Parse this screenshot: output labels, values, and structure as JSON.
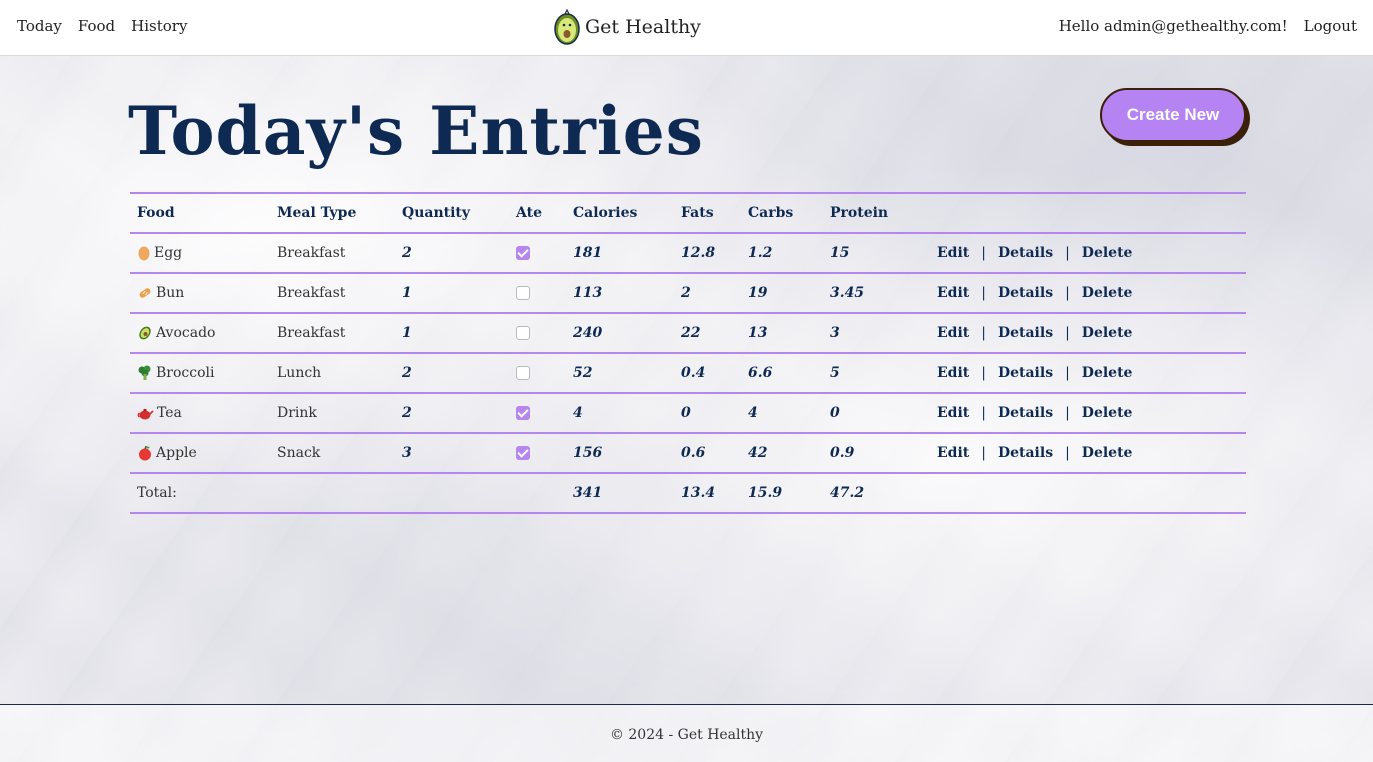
{
  "nav": {
    "links": [
      "Today",
      "Food",
      "History"
    ],
    "brand": "Get Healthy",
    "greeting": "Hello admin@gethealthy.com!",
    "logout": "Logout"
  },
  "page": {
    "title": "Today's Entries",
    "create_button": "Create New"
  },
  "table": {
    "headers": [
      "Food",
      "Meal Type",
      "Quantity",
      "Ate",
      "Calories",
      "Fats",
      "Carbs",
      "Protein"
    ],
    "rows": [
      {
        "icon": "egg-icon",
        "food": "Egg",
        "meal": "Breakfast",
        "qty": "2",
        "ate": true,
        "calories": "181",
        "fats": "12.8",
        "carbs": "1.2",
        "protein": "15"
      },
      {
        "icon": "bread-icon",
        "food": "Bun",
        "meal": "Breakfast",
        "qty": "1",
        "ate": false,
        "calories": "113",
        "fats": "2",
        "carbs": "19",
        "protein": "3.45"
      },
      {
        "icon": "avocado-icon",
        "food": "Avocado",
        "meal": "Breakfast",
        "qty": "1",
        "ate": false,
        "calories": "240",
        "fats": "22",
        "carbs": "13",
        "protein": "3"
      },
      {
        "icon": "broccoli-icon",
        "food": "Broccoli",
        "meal": "Lunch",
        "qty": "2",
        "ate": false,
        "calories": "52",
        "fats": "0.4",
        "carbs": "6.6",
        "protein": "5"
      },
      {
        "icon": "teapot-icon",
        "food": "Tea",
        "meal": "Drink",
        "qty": "2",
        "ate": true,
        "calories": "4",
        "fats": "0",
        "carbs": "4",
        "protein": "0"
      },
      {
        "icon": "apple-icon",
        "food": "Apple",
        "meal": "Snack",
        "qty": "3",
        "ate": true,
        "calories": "156",
        "fats": "0.6",
        "carbs": "42",
        "protein": "0.9"
      }
    ],
    "actions": {
      "edit": "Edit",
      "details": "Details",
      "delete": "Delete",
      "separator": "|"
    },
    "total": {
      "label": "Total:",
      "calories": "341",
      "fats": "13.4",
      "carbs": "15.9",
      "protein": "47.2"
    }
  },
  "footer": {
    "text": "© 2024 - Get Healthy"
  },
  "colors": {
    "accent": "#b486ee",
    "title": "#0f2a52",
    "button": "#b583f2",
    "button_shadow": "#3a2008"
  }
}
